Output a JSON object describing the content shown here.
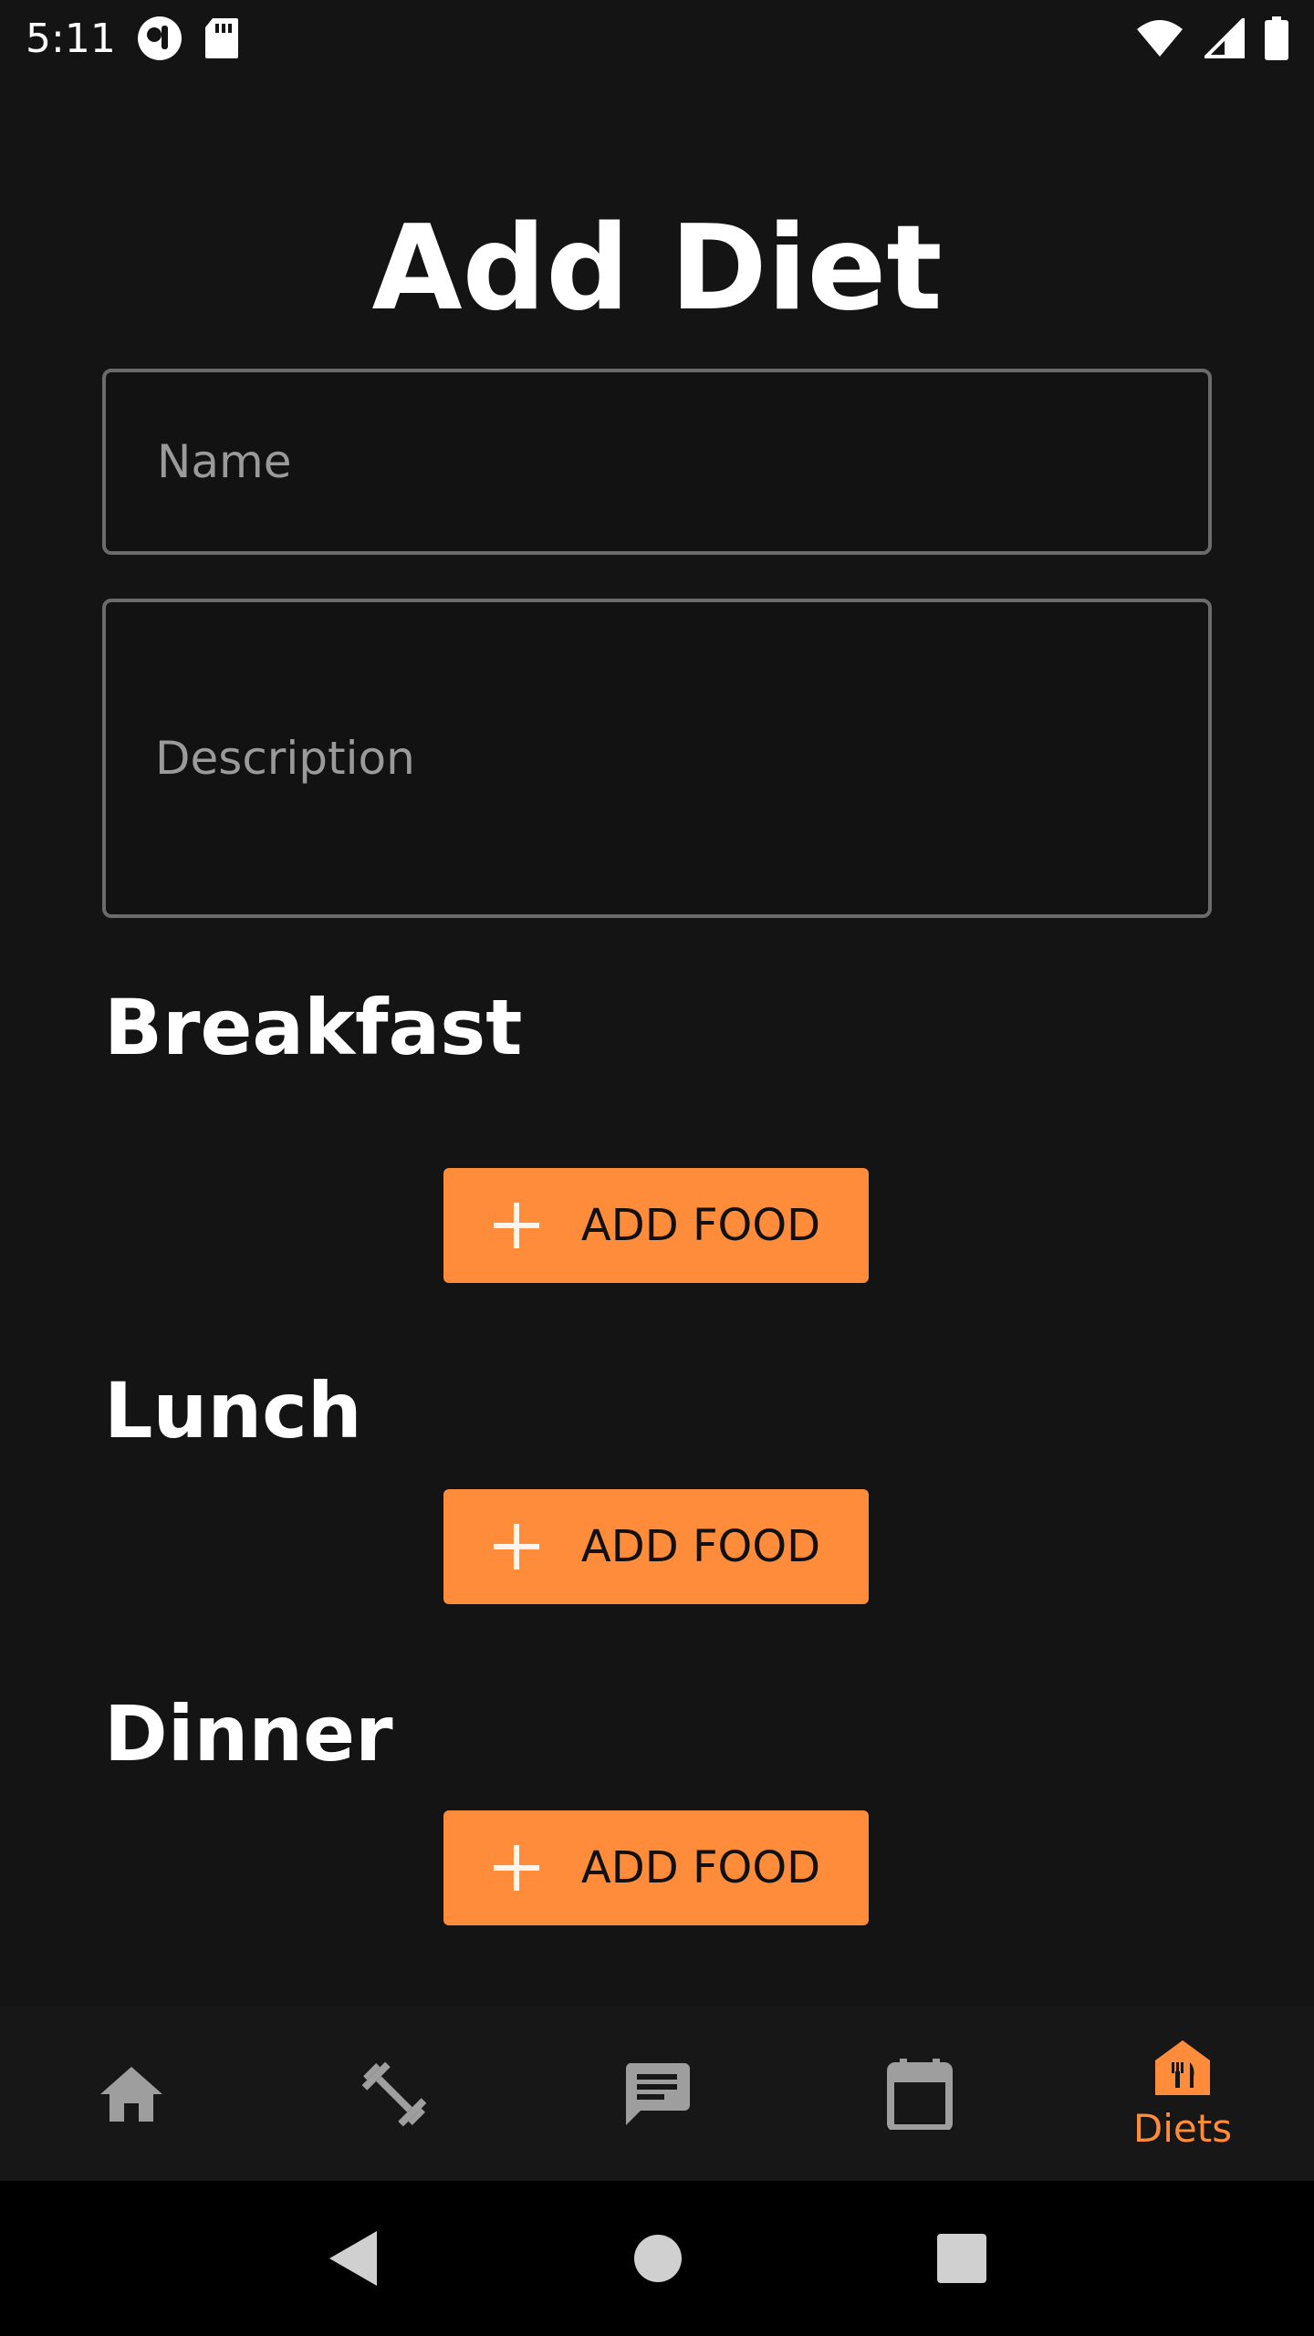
{
  "status_bar": {
    "time": "5:11",
    "icons": [
      "app-notification-icon",
      "sd-card-icon",
      "wifi-icon",
      "cell-signal-icon",
      "battery-icon"
    ]
  },
  "page": {
    "title": "Add Diet"
  },
  "form": {
    "name_placeholder": "Name",
    "name_value": "",
    "description_placeholder": "Description",
    "description_value": ""
  },
  "meals": [
    {
      "title": "Breakfast",
      "button_label": "ADD FOOD"
    },
    {
      "title": "Lunch",
      "button_label": "ADD FOOD"
    },
    {
      "title": "Dinner",
      "button_label": "ADD FOOD"
    }
  ],
  "bottom_nav": {
    "items": [
      {
        "icon": "home-icon",
        "label": ""
      },
      {
        "icon": "dumbbell-icon",
        "label": ""
      },
      {
        "icon": "chat-icon",
        "label": ""
      },
      {
        "icon": "calendar-icon",
        "label": ""
      },
      {
        "icon": "diet-restaurant-icon",
        "label": "Diets",
        "active": true
      }
    ]
  },
  "colors": {
    "background": "#141414",
    "accent": "#ff8c3b",
    "inactive_icon": "#9e9e9e"
  }
}
